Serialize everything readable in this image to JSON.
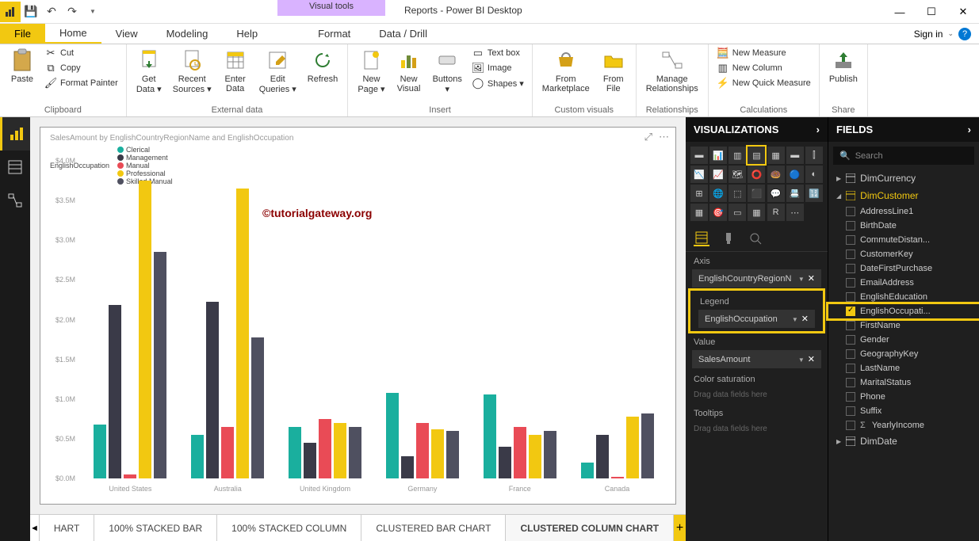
{
  "app": {
    "title": "Reports - Power BI Desktop",
    "visual_tools": "Visual tools",
    "sign_in": "Sign in"
  },
  "qat": {
    "save": "💾",
    "undo": "↶",
    "redo": "↷"
  },
  "win": {
    "min": "—",
    "max": "☐",
    "close": "✕"
  },
  "menu": {
    "file": "File",
    "home": "Home",
    "view": "View",
    "modeling": "Modeling",
    "help": "Help",
    "format": "Format",
    "data_drill": "Data / Drill"
  },
  "ribbon": {
    "clipboard": {
      "label": "Clipboard",
      "paste": "Paste",
      "cut": "Cut",
      "copy": "Copy",
      "format_painter": "Format Painter"
    },
    "external": {
      "label": "External data",
      "get_data": "Get\nData ▾",
      "recent": "Recent\nSources ▾",
      "enter": "Enter\nData",
      "edit": "Edit\nQueries ▾",
      "refresh": "Refresh"
    },
    "insert": {
      "label": "Insert",
      "new_page": "New\nPage ▾",
      "new_visual": "New\nVisual",
      "buttons": "Buttons\n▾",
      "text_box": "Text box",
      "image": "Image",
      "shapes": "Shapes ▾"
    },
    "custom": {
      "label": "Custom visuals",
      "marketplace": "From\nMarketplace",
      "file": "From\nFile"
    },
    "relationships": {
      "label": "Relationships",
      "manage": "Manage\nRelationships"
    },
    "calculations": {
      "label": "Calculations",
      "measure": "New Measure",
      "column": "New Column",
      "quick": "New Quick Measure"
    },
    "share": {
      "label": "Share",
      "publish": "Publish"
    }
  },
  "chart_data": {
    "type": "bar",
    "title": "SalesAmount by EnglishCountryRegionName and EnglishOccupation",
    "legend_label": "EnglishOccupation",
    "ylabel": "SalesAmount",
    "ylim": [
      0,
      4.0
    ],
    "y_unit": "M",
    "y_ticks": [
      "$4.0M",
      "$3.5M",
      "$3.0M",
      "$2.5M",
      "$2.0M",
      "$1.5M",
      "$1.0M",
      "$0.5M",
      "$0.0M"
    ],
    "categories": [
      "United States",
      "Australia",
      "United Kingdom",
      "Germany",
      "France",
      "Canada"
    ],
    "series": [
      {
        "name": "Clerical",
        "color": "#1aaf9e",
        "values": [
          0.68,
          0.55,
          0.65,
          1.08,
          1.06,
          0.2
        ]
      },
      {
        "name": "Management",
        "color": "#3a3a48",
        "values": [
          2.18,
          2.22,
          0.45,
          0.28,
          0.4,
          0.55
        ]
      },
      {
        "name": "Manual",
        "color": "#e94b56",
        "values": [
          0.05,
          0.65,
          0.75,
          0.7,
          0.65,
          0.02
        ]
      },
      {
        "name": "Professional",
        "color": "#f2c811",
        "values": [
          3.75,
          3.65,
          0.7,
          0.62,
          0.55,
          0.78
        ]
      },
      {
        "name": "Skilled Manual",
        "color": "#4f5060",
        "values": [
          2.85,
          1.78,
          0.65,
          0.6,
          0.6,
          0.82
        ]
      }
    ]
  },
  "watermark": "©tutorialgateway.org",
  "pages": {
    "p0": "HART",
    "p1": "100% STACKED BAR",
    "p2": "100% STACKED COLUMN",
    "p3": "CLUSTERED BAR CHART",
    "p4": "CLUSTERED COLUMN CHART"
  },
  "viz_panel": {
    "title": "VISUALIZATIONS",
    "wells": {
      "axis": "Axis",
      "axis_val": "EnglishCountryRegionN",
      "legend": "Legend",
      "legend_val": "EnglishOccupation",
      "value": "Value",
      "value_val": "SalesAmount",
      "color_sat": "Color saturation",
      "drag": "Drag data fields here",
      "tooltips": "Tooltips"
    }
  },
  "fields_panel": {
    "title": "FIELDS",
    "search": "Search",
    "tables": {
      "dim_currency": "DimCurrency",
      "dim_customer": "DimCustomer",
      "dim_date": "DimDate"
    },
    "customer_fields": [
      "AddressLine1",
      "BirthDate",
      "CommuteDistan...",
      "CustomerKey",
      "DateFirstPurchase",
      "EmailAddress",
      "EnglishEducation",
      "EnglishOccupati...",
      "FirstName",
      "Gender",
      "GeographyKey",
      "LastName",
      "MaritalStatus",
      "Phone",
      "Suffix",
      "YearlyIncome"
    ]
  }
}
